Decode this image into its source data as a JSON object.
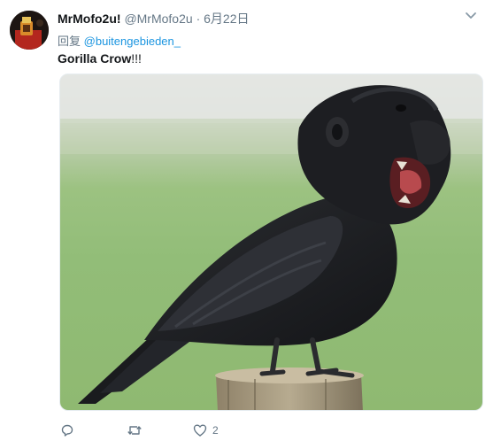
{
  "author": {
    "display_name": "MrMofo2u!",
    "handle": "@MrMofo2u",
    "separator": "·",
    "date": "6月22日"
  },
  "reply_to": {
    "prefix": "回复",
    "handle": "@buitengebieden_"
  },
  "tweet": {
    "text_bold": "Gorilla Crow",
    "text_rest": "!!!"
  },
  "media": {
    "description_icon": "gorilla-crow-photo"
  },
  "actions": {
    "reply_count": "",
    "retweet_count": "",
    "like_count": "2"
  },
  "colors": {
    "link": "#1b95e0",
    "secondary_text": "#657786",
    "primary_text": "#14171a"
  }
}
